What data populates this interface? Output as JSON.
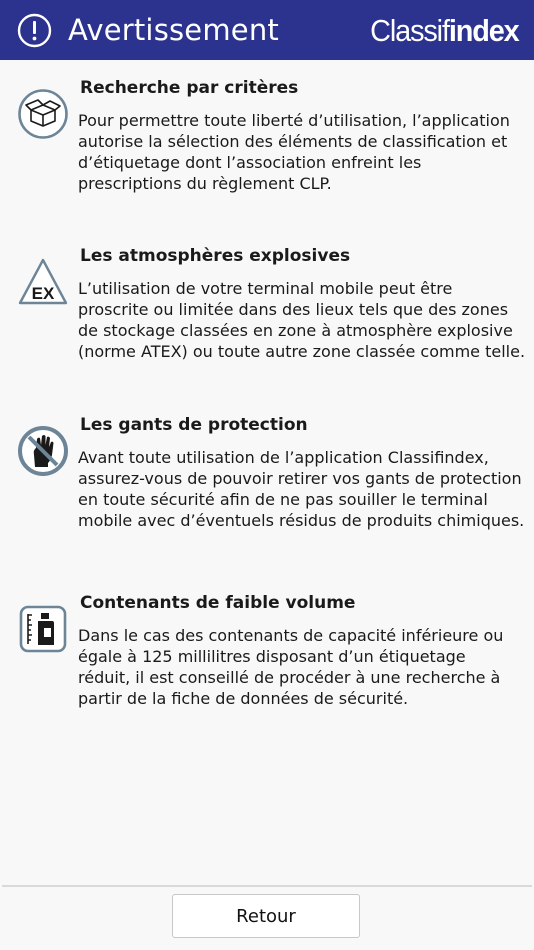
{
  "header": {
    "title": "Avertissement",
    "brand_part1": "Classif",
    "brand_part2": "index",
    "background": "#2b338f",
    "icon": "warning-circle-icon"
  },
  "sections": [
    {
      "title": "Recherche par critères",
      "text": "Pour permettre toute liberté d’utilisation, l’application\nautorise la sélection des éléments de classification et\nd’étiquetage dont l’association enfreint les\nprescriptions du règlement CLP.",
      "icon": "open-box-icon"
    },
    {
      "title": "Les atmosphères explosives",
      "text": "L’utilisation de votre terminal mobile peut être\nproscrite ou limitée dans des lieux tels que des zones\nde stockage classées en zone à atmosphère explosive\n(norme ATEX) ou toute autre zone classée comme telle.",
      "icon": "ex-triangle-icon",
      "icon_label": "EX"
    },
    {
      "title": "Les gants de protection",
      "text": "Avant toute utilisation de l’application Classifindex,\nassurez-vous de pouvoir retirer vos gants de protection\nen toute sécurité afin de ne pas souiller le terminal\nmobile avec d’éventuels résidus de produits chimiques.",
      "icon": "no-gloves-icon"
    },
    {
      "title": "Contenants de faible volume",
      "text": "Dans le cas des contenants de capacité inférieure ou\négale à 125 millilitres disposant d’un étiquetage\nréduit, il est conseillé de procéder à une recherche à\npartir de la fiche de données de sécurité.",
      "icon": "small-container-icon"
    }
  ],
  "footer": {
    "back_label": "Retour"
  },
  "colors": {
    "icon_outline": "#6d8596",
    "text": "#1a1a1a",
    "background": "#f8f8f8"
  }
}
